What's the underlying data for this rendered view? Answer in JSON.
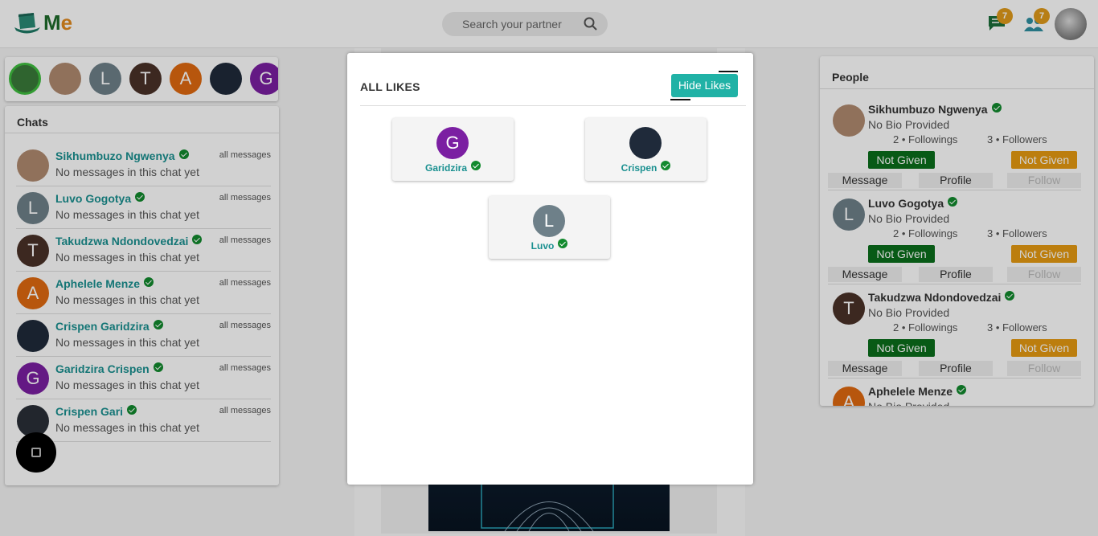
{
  "app": {
    "logo_m": "M",
    "logo_e": "e"
  },
  "search": {
    "placeholder": "Search your partner"
  },
  "header": {
    "messages_badge": "7",
    "people_badge": "7"
  },
  "stories": [
    {
      "letter": "",
      "color": "#3a7a3a"
    },
    {
      "letter": "",
      "color": "#b08a70"
    },
    {
      "letter": "L",
      "color": "#6e8089"
    },
    {
      "letter": "T",
      "color": "#4a3128"
    },
    {
      "letter": "A",
      "color": "#e06a10"
    },
    {
      "letter": "",
      "color": "#1f2a3a"
    },
    {
      "letter": "G",
      "color": "#7b1fa2"
    }
  ],
  "chats": {
    "title": "Chats",
    "all_label": "all messages",
    "items": [
      {
        "name": "Sikhumbuzo Ngwenya",
        "message": "No messages in this chat yet",
        "letter": "",
        "color": "#b08a70"
      },
      {
        "name": "Luvo Gogotya",
        "message": "No messages in this chat yet",
        "letter": "L",
        "color": "#6e8089"
      },
      {
        "name": "Takudzwa Ndondovedzai",
        "message": "No messages in this chat yet",
        "letter": "T",
        "color": "#4a3128"
      },
      {
        "name": "Aphelele Menze",
        "message": "No messages in this chat yet",
        "letter": "A",
        "color": "#e06a10"
      },
      {
        "name": "Crispen Garidzira",
        "message": "No messages in this chat yet",
        "letter": "",
        "color": "#1f2a3a"
      },
      {
        "name": "Garidzira Crispen",
        "message": "No messages in this chat yet",
        "letter": "G",
        "color": "#7b1fa2"
      },
      {
        "name": "Crispen Gari",
        "message": "No messages in this chat yet",
        "letter": "",
        "color": "#2a2f38"
      }
    ]
  },
  "people": {
    "title": "People",
    "message_label": "Message",
    "profile_label": "Profile",
    "follow_label": "Follow",
    "not_given": "Not Given",
    "items": [
      {
        "name": "Sikhumbuzo Ngwenya",
        "bio": "No Bio Provided",
        "followings": "2 • Followings",
        "followers": "3 • Followers",
        "letter": "",
        "color": "#b08a70"
      },
      {
        "name": "Luvo Gogotya",
        "bio": "No Bio Provided",
        "followings": "2 • Followings",
        "followers": "3 • Followers",
        "letter": "L",
        "color": "#6e8089"
      },
      {
        "name": "Takudzwa Ndondovedzai",
        "bio": "No Bio Provided",
        "followings": "2 • Followings",
        "followers": "3 • Followers",
        "letter": "T",
        "color": "#4a3128"
      },
      {
        "name": "Aphelele Menze",
        "bio": "No Bio Provided",
        "followings": "",
        "followers": "",
        "letter": "A",
        "color": "#e06a10"
      }
    ]
  },
  "modal": {
    "title": "ALL LIKES",
    "hide_label": "Hide Likes",
    "likes": [
      {
        "name": "Garidzira",
        "letter": "G",
        "color": "#7b1fa2"
      },
      {
        "name": "Crispen",
        "letter": "",
        "color": "#1f2a3a"
      },
      {
        "name": "Luvo",
        "letter": "L",
        "color": "#6e8089"
      }
    ]
  }
}
